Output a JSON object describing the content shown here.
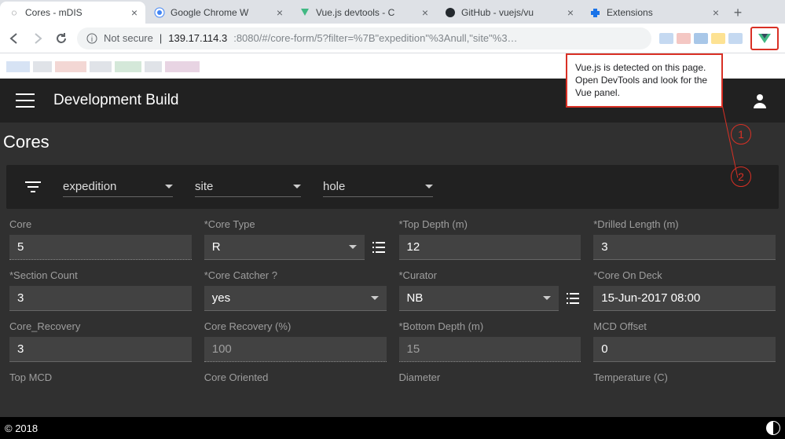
{
  "browser": {
    "tabs": [
      {
        "title": "Cores - mDIS"
      },
      {
        "title": "Google Chrome W"
      },
      {
        "title": "Vue.js devtools - C"
      },
      {
        "title": "GitHub - vuejs/vu"
      },
      {
        "title": "Extensions"
      }
    ],
    "secure_label": "Not secure",
    "url_host": "139.17.114.3",
    "url_path": ":8080/#/core-form/5?filter=%7B\"expedition\"%3Anull,\"site\"%3…"
  },
  "tooltip": {
    "text": "Vue.js is detected on this page. Open DevTools and look for the Vue panel."
  },
  "annotations": {
    "c1": "1",
    "c2": "2"
  },
  "app": {
    "appbar_title": "Development Build",
    "page_title": "Cores",
    "filters": {
      "f1": "expedition",
      "f2": "site",
      "f3": "hole"
    },
    "fields": {
      "core": {
        "label": "Core",
        "value": "5"
      },
      "core_type": {
        "label": "*Core Type",
        "value": "R"
      },
      "top_depth": {
        "label": "*Top Depth (m)",
        "value": "12"
      },
      "drilled_len": {
        "label": "*Drilled Length (m)",
        "value": "3"
      },
      "section_count": {
        "label": "*Section Count",
        "value": "3"
      },
      "core_catcher": {
        "label": "*Core Catcher ?",
        "value": "yes"
      },
      "curator": {
        "label": "*Curator",
        "value": "NB"
      },
      "core_on_deck": {
        "label": "*Core On Deck",
        "value": "15-Jun-2017 08:00"
      },
      "core_recovery": {
        "label": "Core_Recovery",
        "value": "3"
      },
      "core_recovery_pct": {
        "label": "Core Recovery (%)",
        "value": "100"
      },
      "bottom_depth": {
        "label": "*Bottom Depth (m)",
        "value": "15"
      },
      "mcd_offset": {
        "label": "MCD Offset",
        "value": "0"
      },
      "top_mcd": {
        "label": "Top MCD"
      },
      "core_oriented": {
        "label": "Core Oriented"
      },
      "diameter": {
        "label": "Diameter"
      },
      "temperature": {
        "label": "Temperature (C)"
      }
    },
    "footer": "© 2018"
  }
}
